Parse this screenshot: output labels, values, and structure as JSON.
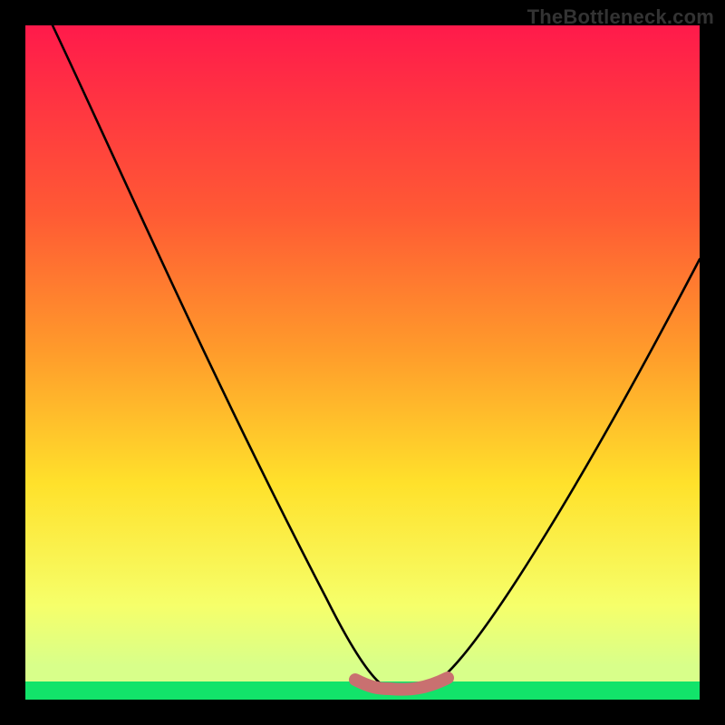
{
  "watermark": {
    "text": "TheBottleneck.com"
  },
  "chart_data": {
    "type": "line",
    "title": "",
    "xlabel": "",
    "ylabel": "",
    "xlim": [
      0,
      100
    ],
    "ylim": [
      0,
      100
    ],
    "grid": false,
    "legend": false,
    "background_gradient": {
      "top": "#ff1a4b",
      "mid_upper": "#ff8a2b",
      "mid": "#ffe12b",
      "mid_lower": "#f6ff6a",
      "bottom_band": "#12e36a"
    },
    "series": [
      {
        "name": "bottleneck-curve",
        "stroke": "#000000",
        "x": [
          4,
          10,
          18,
          26,
          34,
          42,
          48,
          50,
          54,
          58,
          60,
          62,
          66,
          72,
          80,
          88,
          98
        ],
        "y": [
          100,
          88,
          73,
          58,
          43,
          28,
          12,
          6,
          2,
          2,
          2,
          4,
          10,
          22,
          38,
          52,
          68
        ]
      },
      {
        "name": "optimal-zone-marker",
        "stroke": "#c86a6a",
        "x": [
          48,
          50,
          52,
          54,
          56,
          58,
          60,
          62
        ],
        "y": [
          3,
          2.4,
          2,
          2,
          2,
          2,
          2.4,
          3
        ]
      }
    ],
    "annotations": []
  }
}
